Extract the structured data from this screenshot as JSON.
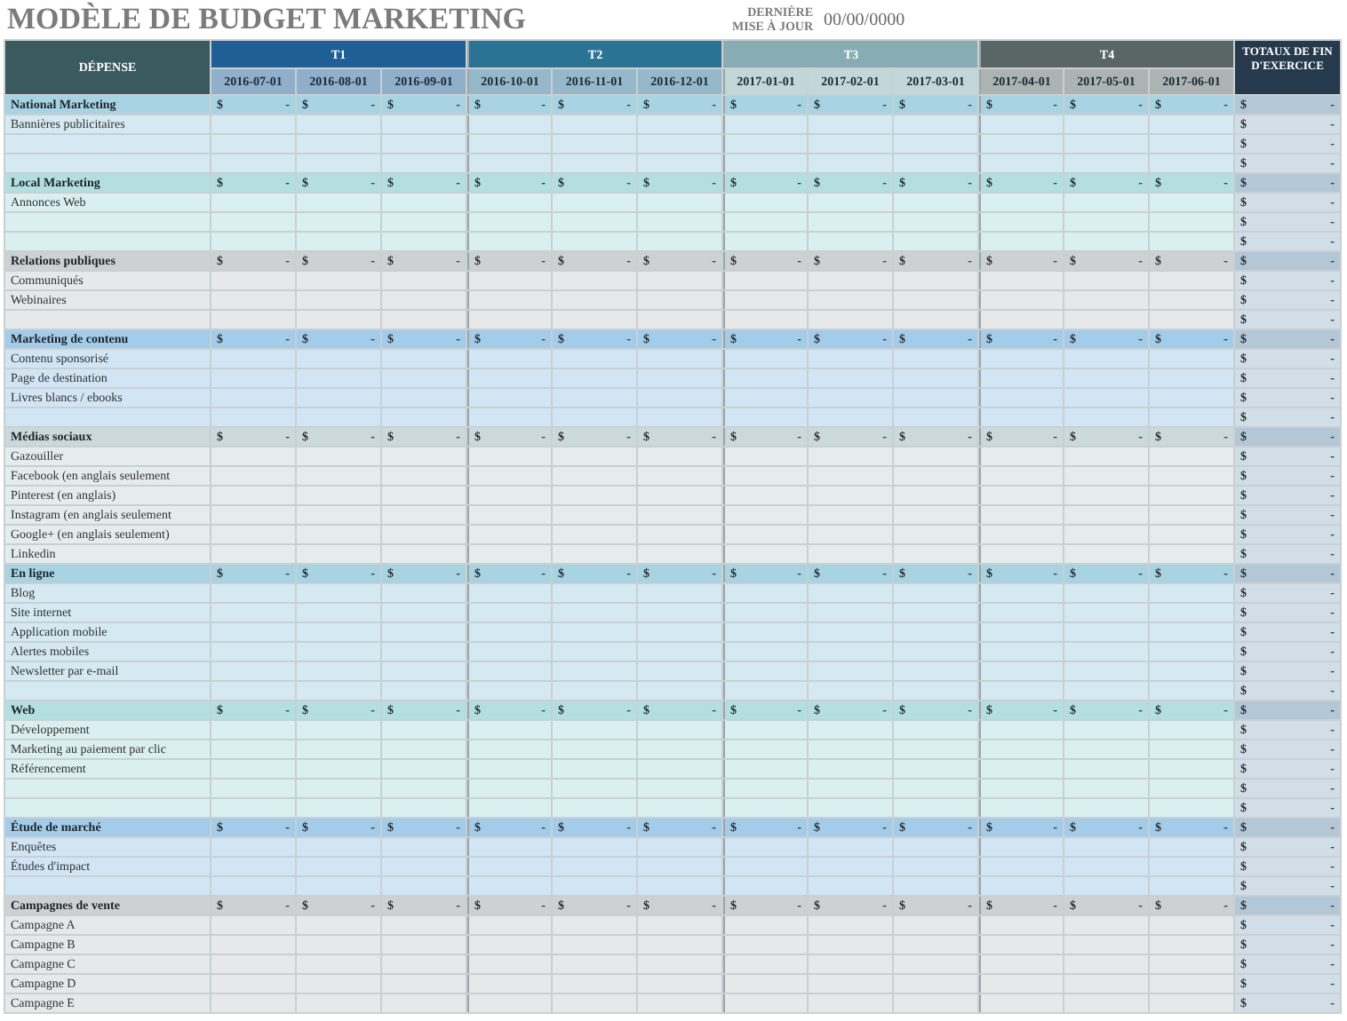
{
  "title": "MODÈLE DE BUDGET MARKETING",
  "last_updated": {
    "label_lines": [
      "DERNIÈRE",
      "MISE À JOUR"
    ],
    "value": "00/00/0000"
  },
  "table": {
    "expense_header": "DÉPENSE",
    "totals_header": "TOTAUX DE FIN D'EXERCICE",
    "quarters": [
      {
        "label": "T1",
        "color": "#1f5f96",
        "months": [
          "2016-07-01",
          "2016-08-01",
          "2016-09-01"
        ]
      },
      {
        "label": "T2",
        "color": "#2a7395",
        "months": [
          "2016-10-01",
          "2016-11-01",
          "2016-12-01"
        ]
      },
      {
        "label": "T3",
        "color": "#87adb3",
        "months": [
          "2017-01-01",
          "2017-02-01",
          "2017-03-01"
        ]
      },
      {
        "label": "T4",
        "color": "#5a6665",
        "months": [
          "2017-04-01",
          "2017-05-01",
          "2017-06-01"
        ]
      }
    ],
    "sections": [
      {
        "name": "National Marketing",
        "color": "#a8d3e3",
        "months": [
          {
            "currency": "$",
            "value": "-"
          },
          {
            "currency": "$",
            "value": "-"
          },
          {
            "currency": "$",
            "value": "-"
          },
          {
            "currency": "$",
            "value": "-"
          },
          {
            "currency": "$",
            "value": "-"
          },
          {
            "currency": "$",
            "value": "-"
          },
          {
            "currency": "$",
            "value": "-"
          },
          {
            "currency": "$",
            "value": "-"
          },
          {
            "currency": "$",
            "value": "-"
          },
          {
            "currency": "$",
            "value": "-"
          },
          {
            "currency": "$",
            "value": "-"
          },
          {
            "currency": "$",
            "value": "-"
          }
        ],
        "total": {
          "currency": "$",
          "value": "-"
        },
        "rows": [
          {
            "label": "Bannières publicitaires",
            "total": {
              "currency": "$",
              "value": "-"
            }
          },
          {
            "total": {
              "currency": "$",
              "value": "-"
            }
          },
          {
            "total": {
              "currency": "$",
              "value": "-"
            }
          }
        ]
      },
      {
        "name": "Local Marketing",
        "color": "#b4dfe0",
        "months": [
          {
            "currency": "$",
            "value": "-"
          },
          {
            "currency": "$",
            "value": "-"
          },
          {
            "currency": "$",
            "value": "-"
          },
          {
            "currency": "$",
            "value": "-"
          },
          {
            "currency": "$",
            "value": "-"
          },
          {
            "currency": "$",
            "value": "-"
          },
          {
            "currency": "$",
            "value": "-"
          },
          {
            "currency": "$",
            "value": "-"
          },
          {
            "currency": "$",
            "value": "-"
          },
          {
            "currency": "$",
            "value": "-"
          },
          {
            "currency": "$",
            "value": "-"
          },
          {
            "currency": "$",
            "value": "-"
          }
        ],
        "total": {
          "currency": "$",
          "value": "-"
        },
        "rows": [
          {
            "label": "Annonces Web",
            "total": {
              "currency": "$",
              "value": "-"
            }
          },
          {
            "total": {
              "currency": "$",
              "value": "-"
            }
          },
          {
            "total": {
              "currency": "$",
              "value": "-"
            }
          }
        ]
      },
      {
        "name": "Relations publiques",
        "color": "#cdd1d3",
        "months": [
          {
            "currency": "$",
            "value": "-"
          },
          {
            "currency": "$",
            "value": "-"
          },
          {
            "currency": "$",
            "value": "-"
          },
          {
            "currency": "$",
            "value": "-"
          },
          {
            "currency": "$",
            "value": "-"
          },
          {
            "currency": "$",
            "value": "-"
          },
          {
            "currency": "$",
            "value": "-"
          },
          {
            "currency": "$",
            "value": "-"
          },
          {
            "currency": "$",
            "value": "-"
          },
          {
            "currency": "$",
            "value": "-"
          },
          {
            "currency": "$",
            "value": "-"
          },
          {
            "currency": "$",
            "value": "-"
          }
        ],
        "total": {
          "currency": "$",
          "value": "-"
        },
        "rows": [
          {
            "label": "Communiqués",
            "total": {
              "currency": "$",
              "value": "-"
            }
          },
          {
            "label": "Webinaires",
            "total": {
              "currency": "$",
              "value": "-"
            }
          },
          {
            "total": {
              "currency": "$",
              "value": "-"
            }
          }
        ]
      },
      {
        "name": "Marketing de contenu",
        "color": "#a3cbea",
        "months": [
          {
            "currency": "$",
            "value": "-"
          },
          {
            "currency": "$",
            "value": "-"
          },
          {
            "currency": "$",
            "value": "-"
          },
          {
            "currency": "$",
            "value": "-"
          },
          {
            "currency": "$",
            "value": "-"
          },
          {
            "currency": "$",
            "value": "-"
          },
          {
            "currency": "$",
            "value": "-"
          },
          {
            "currency": "$",
            "value": "-"
          },
          {
            "currency": "$",
            "value": "-"
          },
          {
            "currency": "$",
            "value": "-"
          },
          {
            "currency": "$",
            "value": "-"
          },
          {
            "currency": "$",
            "value": "-"
          }
        ],
        "total": {
          "currency": "$",
          "value": "-"
        },
        "rows": [
          {
            "label": "Contenu sponsorisé",
            "total": {
              "currency": "$",
              "value": "-"
            }
          },
          {
            "label": "Page de destination",
            "total": {
              "currency": "$",
              "value": "-"
            }
          },
          {
            "label": "Livres blancs / ebooks",
            "total": {
              "currency": "$",
              "value": "-"
            }
          },
          {
            "total": {
              "currency": "$",
              "value": "-"
            }
          }
        ]
      },
      {
        "name": "Médias sociaux",
        "color": "#cbd8dc",
        "months": [
          {
            "currency": "$",
            "value": "-"
          },
          {
            "currency": "$",
            "value": "-"
          },
          {
            "currency": "$",
            "value": "-"
          },
          {
            "currency": "$",
            "value": "-"
          },
          {
            "currency": "$",
            "value": "-"
          },
          {
            "currency": "$",
            "value": "-"
          },
          {
            "currency": "$",
            "value": "-"
          },
          {
            "currency": "$",
            "value": "-"
          },
          {
            "currency": "$",
            "value": "-"
          },
          {
            "currency": "$",
            "value": "-"
          },
          {
            "currency": "$",
            "value": "-"
          },
          {
            "currency": "$",
            "value": "-"
          }
        ],
        "total": {
          "currency": "$",
          "value": "-"
        },
        "rows": [
          {
            "label": "Gazouiller",
            "total": {
              "currency": "$",
              "value": "-"
            }
          },
          {
            "label": "Facebook (en anglais seulement",
            "total": {
              "currency": "$",
              "value": "-"
            }
          },
          {
            "label": "Pinterest (en anglais)",
            "total": {
              "currency": "$",
              "value": "-"
            }
          },
          {
            "label": "Instagram (en anglais seulement",
            "total": {
              "currency": "$",
              "value": "-"
            }
          },
          {
            "label": "Google+ (en anglais seulement)",
            "total": {
              "currency": "$",
              "value": "-"
            }
          },
          {
            "label": "Linkedin",
            "total": {
              "currency": "$",
              "value": "-"
            }
          }
        ]
      },
      {
        "name": "En ligne",
        "color": "#a8d3e3",
        "months": [
          {
            "currency": "$",
            "value": "-"
          },
          {
            "currency": "$",
            "value": "-"
          },
          {
            "currency": "$",
            "value": "-"
          },
          {
            "currency": "$",
            "value": "-"
          },
          {
            "currency": "$",
            "value": "-"
          },
          {
            "currency": "$",
            "value": "-"
          },
          {
            "currency": "$",
            "value": "-"
          },
          {
            "currency": "$",
            "value": "-"
          },
          {
            "currency": "$",
            "value": "-"
          },
          {
            "currency": "$",
            "value": "-"
          },
          {
            "currency": "$",
            "value": "-"
          },
          {
            "currency": "$",
            "value": "-"
          }
        ],
        "total": {
          "currency": "$",
          "value": "-"
        },
        "rows": [
          {
            "label": "Blog",
            "total": {
              "currency": "$",
              "value": "-"
            }
          },
          {
            "label": "Site internet",
            "total": {
              "currency": "$",
              "value": "-"
            }
          },
          {
            "label": "Application mobile",
            "total": {
              "currency": "$",
              "value": "-"
            }
          },
          {
            "label": "Alertes mobiles",
            "total": {
              "currency": "$",
              "value": "-"
            }
          },
          {
            "label": "Newsletter par e-mail",
            "total": {
              "currency": "$",
              "value": "-"
            }
          },
          {
            "total": {
              "currency": "$",
              "value": "-"
            }
          }
        ]
      },
      {
        "name": "Web",
        "color": "#b4dfe0",
        "months": [
          {
            "currency": "$",
            "value": "-"
          },
          {
            "currency": "$",
            "value": "-"
          },
          {
            "currency": "$",
            "value": "-"
          },
          {
            "currency": "$",
            "value": "-"
          },
          {
            "currency": "$",
            "value": "-"
          },
          {
            "currency": "$",
            "value": "-"
          },
          {
            "currency": "$",
            "value": "-"
          },
          {
            "currency": "$",
            "value": "-"
          },
          {
            "currency": "$",
            "value": "-"
          },
          {
            "currency": "$",
            "value": "-"
          },
          {
            "currency": "$",
            "value": "-"
          },
          {
            "currency": "$",
            "value": "-"
          }
        ],
        "total": {
          "currency": "$",
          "value": "-"
        },
        "rows": [
          {
            "label": "Développement",
            "total": {
              "currency": "$",
              "value": "-"
            }
          },
          {
            "label": "Marketing au paiement par clic",
            "total": {
              "currency": "$",
              "value": "-"
            }
          },
          {
            "label": "Référencement",
            "total": {
              "currency": "$",
              "value": "-"
            }
          },
          {
            "total": {
              "currency": "$",
              "value": "-"
            }
          },
          {
            "total": {
              "currency": "$",
              "value": "-"
            }
          }
        ]
      },
      {
        "name": "Étude de marché",
        "color": "#a3cbea",
        "months": [
          {
            "currency": "$",
            "value": "-"
          },
          {
            "currency": "$",
            "value": "-"
          },
          {
            "currency": "$",
            "value": "-"
          },
          {
            "currency": "$",
            "value": "-"
          },
          {
            "currency": "$",
            "value": "-"
          },
          {
            "currency": "$",
            "value": "-"
          },
          {
            "currency": "$",
            "value": "-"
          },
          {
            "currency": "$",
            "value": "-"
          },
          {
            "currency": "$",
            "value": "-"
          },
          {
            "currency": "$",
            "value": "-"
          },
          {
            "currency": "$",
            "value": "-"
          },
          {
            "currency": "$",
            "value": "-"
          }
        ],
        "total": {
          "currency": "$",
          "value": "-"
        },
        "rows": [
          {
            "label": "Enquêtes",
            "total": {
              "currency": "$",
              "value": "-"
            }
          },
          {
            "label": "Études d'impact",
            "total": {
              "currency": "$",
              "value": "-"
            }
          },
          {
            "total": {
              "currency": "$",
              "value": "-"
            }
          }
        ]
      },
      {
        "name": "Campagnes de vente",
        "color": "#cdd1d3",
        "months": [
          {
            "currency": "$",
            "value": "-"
          },
          {
            "currency": "$",
            "value": "-"
          },
          {
            "currency": "$",
            "value": "-"
          },
          {
            "currency": "$",
            "value": "-"
          },
          {
            "currency": "$",
            "value": "-"
          },
          {
            "currency": "$",
            "value": "-"
          },
          {
            "currency": "$",
            "value": "-"
          },
          {
            "currency": "$",
            "value": "-"
          },
          {
            "currency": "$",
            "value": "-"
          },
          {
            "currency": "$",
            "value": "-"
          },
          {
            "currency": "$",
            "value": "-"
          },
          {
            "currency": "$",
            "value": "-"
          }
        ],
        "total": {
          "currency": "$",
          "value": "-"
        },
        "rows": [
          {
            "label": "Campagne A",
            "total": {
              "currency": "$",
              "value": "-"
            }
          },
          {
            "label": "Campagne B",
            "total": {
              "currency": "$",
              "value": "-"
            }
          },
          {
            "label": "Campagne C",
            "total": {
              "currency": "$",
              "value": "-"
            }
          },
          {
            "label": "Campagne D",
            "total": {
              "currency": "$",
              "value": "-"
            }
          },
          {
            "label": "Campagne E",
            "total": {
              "currency": "$",
              "value": "-"
            }
          }
        ]
      }
    ]
  }
}
